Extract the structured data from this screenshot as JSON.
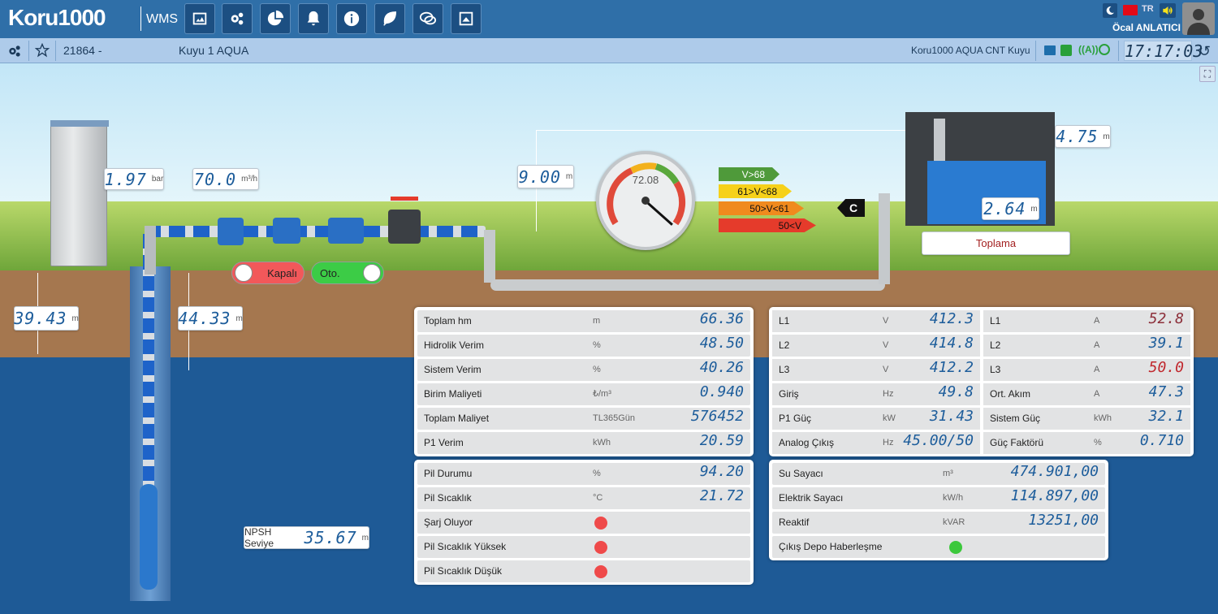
{
  "app": {
    "logo_text": "Koru1000",
    "product": "WMS",
    "user_name": "Öcal ANLATICI",
    "lang": "TR"
  },
  "toolbar_icons": [
    "image-icon",
    "settings-icon",
    "chart-pie-icon",
    "bell-icon",
    "info-icon",
    "leaf-icon",
    "chat-icon",
    "picture-box-icon"
  ],
  "subbar": {
    "station_id": "21864 -",
    "station_name": "Kuyu 1 AQUA",
    "device_name": "Koru1000 AQUA CNT Kuyu",
    "clock": "17:17:03"
  },
  "scene": {
    "pressure": {
      "value": "1.97",
      "unit": "bar"
    },
    "flow": {
      "value": "70.0",
      "unit": "m³/h"
    },
    "head_height": {
      "value": "9.00",
      "unit": "m"
    },
    "static_level": {
      "value": "39.43",
      "unit": "m"
    },
    "dynamic_level": {
      "value": "44.33",
      "unit": "m"
    },
    "tank_height": {
      "value": "4.75",
      "unit": "m"
    },
    "tank_level": {
      "value": "2.64",
      "unit": "m"
    },
    "tank_name": "Toplama",
    "npsh": {
      "label": "NPSH Seviye",
      "value": "35.67",
      "unit": "m"
    },
    "valve_toggle": "Kapalı",
    "mode_toggle": "Oto.",
    "gauge": {
      "value": "72.08",
      "fraction": 0.72
    },
    "efficiency_bands": [
      "V>68",
      "61>V<68",
      "50>V<61",
      "50<V"
    ],
    "efficiency_class": "C",
    "band_colors": [
      "#4f9a3a",
      "#f6d11a",
      "#f08a1e",
      "#e53b2b"
    ]
  },
  "panel_left": [
    {
      "name": "Toplam hm",
      "unit": "m",
      "value": "66.36"
    },
    {
      "name": "Hidrolik Verim",
      "unit": "%",
      "value": "48.50"
    },
    {
      "name": "Sistem Verim",
      "unit": "%",
      "value": "40.26"
    },
    {
      "name": "Birim Maliyeti",
      "unit": "₺/m³",
      "value": "0.940"
    },
    {
      "name": "Toplam Maliyet",
      "unit": "TL365Gün",
      "value": "576452"
    },
    {
      "name": "P1 Verim",
      "unit": "kWh",
      "value": "20.59"
    }
  ],
  "panel_right": [
    {
      "name": "L1",
      "unit": "V",
      "value": "412.3",
      "name2": "L1",
      "unit2": "A",
      "value2": "52.8"
    },
    {
      "name": "L2",
      "unit": "V",
      "value": "414.8",
      "name2": "L2",
      "unit2": "A",
      "value2": "39.1"
    },
    {
      "name": "L3",
      "unit": "V",
      "value": "412.2",
      "name2": "L3",
      "unit2": "A",
      "value2": "50.0"
    },
    {
      "name": "Giriş",
      "unit": "Hz",
      "value": "49.8",
      "name2": "Ort. Akım",
      "unit2": "A",
      "value2": "47.3"
    },
    {
      "name": "P1 Güç",
      "unit": "kW",
      "value": "31.43",
      "name2": "Sistem Güç",
      "unit2": "kWh",
      "value2": "32.1"
    },
    {
      "name": "Analog Çıkış",
      "unit": "Hz",
      "value": "45.00/50",
      "name2": "Güç Faktörü",
      "unit2": "%",
      "value2": "0.710"
    }
  ],
  "panel_battery": [
    {
      "name": "Pil Durumu",
      "unit": "%",
      "value": "94.20"
    },
    {
      "name": "Pil Sıcaklık",
      "unit": "°C",
      "value": "21.72"
    },
    {
      "name": "Şarj Oluyor",
      "status": "red"
    },
    {
      "name": "Pil Sıcaklık Yüksek",
      "status": "red"
    },
    {
      "name": "Pil Sıcaklık Düşük",
      "status": "red"
    }
  ],
  "panel_meters": [
    {
      "name": "Su Sayacı",
      "unit": "m³",
      "value": "474.901,00"
    },
    {
      "name": "Elektrik Sayacı",
      "unit": "kW/h",
      "value": "114.897,00"
    },
    {
      "name": "Reaktif",
      "unit": "kVAR",
      "value": "13251,00"
    },
    {
      "name": "Çıkış Depo Haberleşme",
      "status": "green"
    }
  ],
  "colors": {
    "red_value": "#c0272d",
    "alert_dot": "#ef4a4a",
    "ok_dot": "#3cc83c",
    "off_toggle": "#f2585a",
    "on_toggle": "#3ccc46"
  }
}
